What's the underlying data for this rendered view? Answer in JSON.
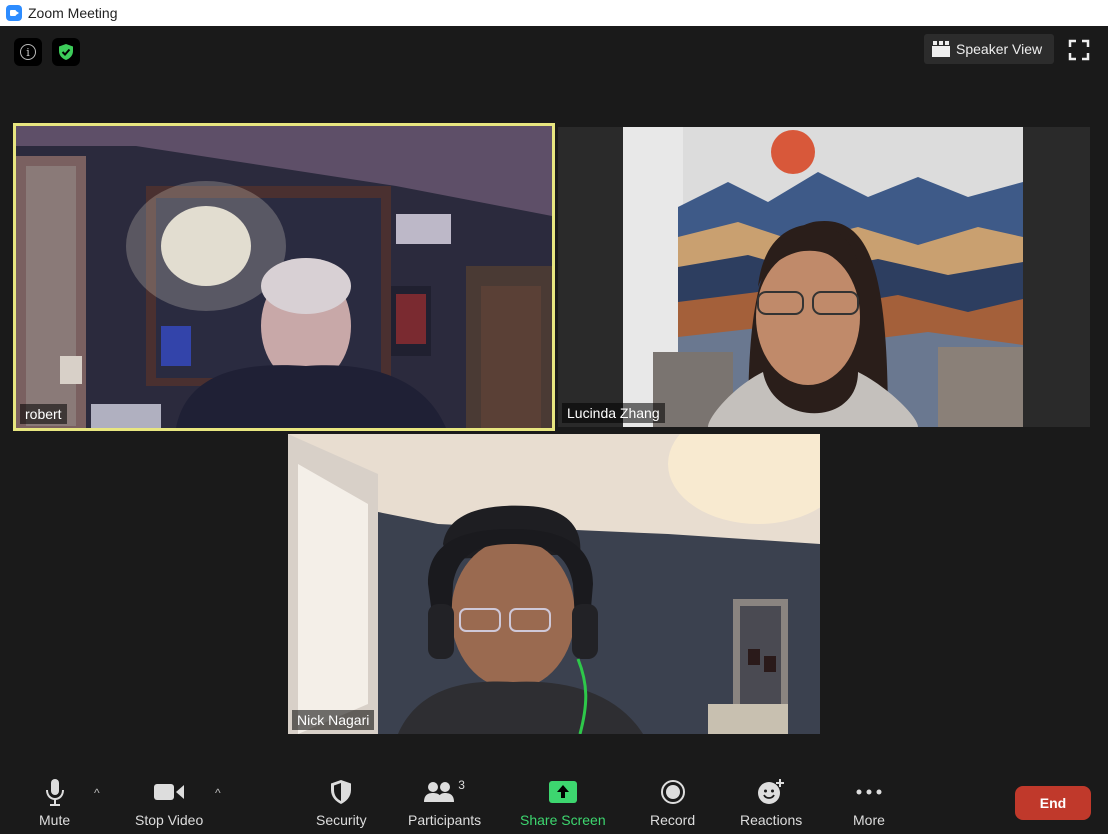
{
  "window": {
    "title": "Zoom Meeting"
  },
  "top_controls": {
    "speaker_view_label": "Speaker View"
  },
  "participants": [
    {
      "name": "robert"
    },
    {
      "name": "Lucinda Zhang"
    },
    {
      "name": "Nick Nagari"
    }
  ],
  "toolbar": {
    "mute_label": "Mute",
    "stop_video_label": "Stop Video",
    "security_label": "Security",
    "participants_label": "Participants",
    "participants_count": "3",
    "share_screen_label": "Share Screen",
    "record_label": "Record",
    "reactions_label": "Reactions",
    "more_label": "More",
    "end_label": "End"
  },
  "colors": {
    "active_speaker_border": "#e8e680",
    "share_green": "#3dd66f",
    "end_red": "#c0392b",
    "background": "#1a1a1a"
  },
  "icons": [
    "zoom-app-icon",
    "info-icon",
    "security-shield-icon",
    "speaker-view-icon",
    "fullscreen-icon",
    "microphone-icon",
    "video-camera-icon",
    "shield-icon",
    "participants-icon",
    "share-screen-icon",
    "record-icon",
    "reactions-icon",
    "more-icon"
  ]
}
